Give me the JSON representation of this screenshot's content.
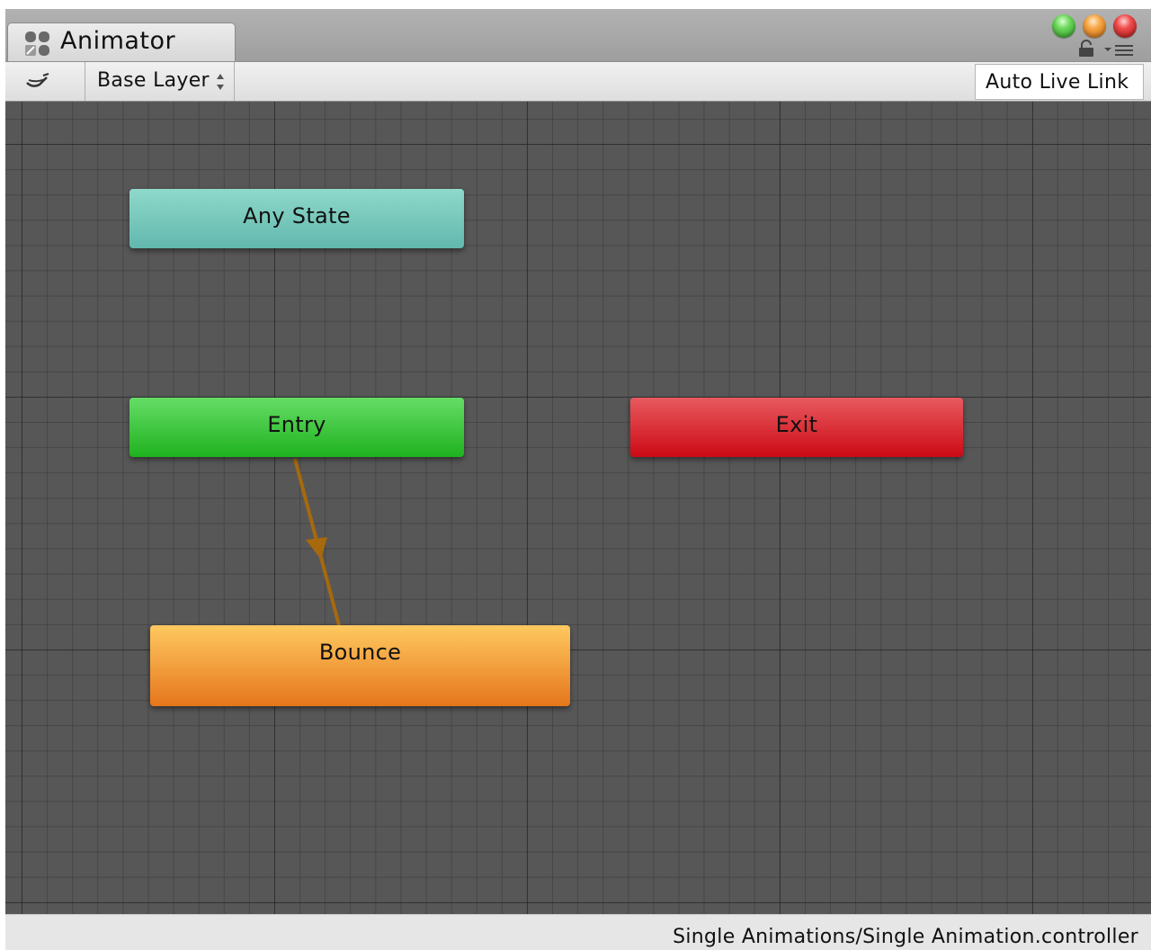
{
  "window": {
    "tab_title": "Animator",
    "tab_icon": "animator-icon",
    "controls": [
      "green-dot",
      "orange-dot",
      "red-dot"
    ],
    "extra_icons": [
      "lock-icon",
      "menu-icon"
    ]
  },
  "toolbar": {
    "sidebar_toggle_icon": "eye-icon",
    "layer_label": "Base Layer",
    "layer_arrows_icon": "up-down-arrows-icon",
    "live_link_label": "Auto Live Link"
  },
  "graph": {
    "states": {
      "any_state": "Any State",
      "entry": "Entry",
      "exit": "Exit",
      "bounce": "Bounce"
    },
    "transitions": [
      {
        "from": "Entry",
        "to": "Bounce"
      }
    ],
    "colors": {
      "any_state": "#74c7bb",
      "entry": "#22b422",
      "exit": "#d60f18",
      "bounce": "#f29a36",
      "transition": "#a6690e",
      "background": "#575757"
    }
  },
  "status": {
    "path": "Single Animations/Single Animation.controller"
  }
}
